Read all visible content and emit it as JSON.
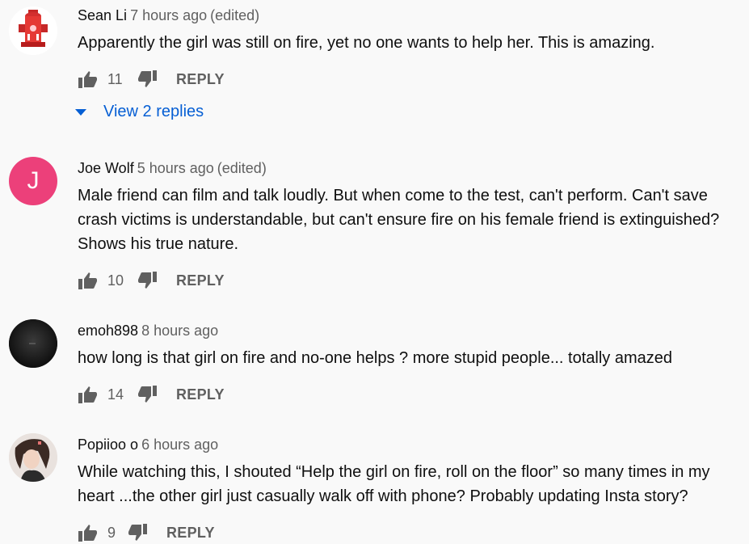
{
  "comments": [
    {
      "author": "Sean Li",
      "time": "7 hours ago",
      "edited": "(edited)",
      "text": "Apparently the girl was still on fire, yet no one wants to help her. This is amazing.",
      "likes": "11",
      "reply_label": "REPLY",
      "avatar_icon": "fire-hydrant-icon",
      "view_replies": "View 2 replies"
    },
    {
      "author": "Joe Wolf",
      "time": "5 hours ago",
      "edited": "(edited)",
      "text": "Male friend can film and talk loudly. But when come to the test, can't perform. Can't save crash victims is understandable, but can't ensure fire on his female friend is extinguished? Shows his true nature.",
      "likes": "10",
      "reply_label": "REPLY",
      "avatar_letter": "J",
      "avatar_color": "#ec407a"
    },
    {
      "author": "emoh898",
      "time": "8 hours ago",
      "text": "how long is that girl on fire and no-one helps ? more stupid people... totally amazed",
      "likes": "14",
      "reply_label": "REPLY",
      "avatar_icon": "dark-photo-icon"
    },
    {
      "author": "Popiioo o",
      "time": "6 hours ago",
      "text": "While watching this, I shouted “Help the girl on fire, roll on the floor” so many times in my heart ...the other girl just casually walk off with phone? Probably updating Insta story?",
      "likes": "9",
      "reply_label": "REPLY",
      "avatar_icon": "person-photo-icon"
    }
  ],
  "colors": {
    "background": "#f9f9f9",
    "link_blue": "#065fd4",
    "secondary_text": "#606060"
  }
}
